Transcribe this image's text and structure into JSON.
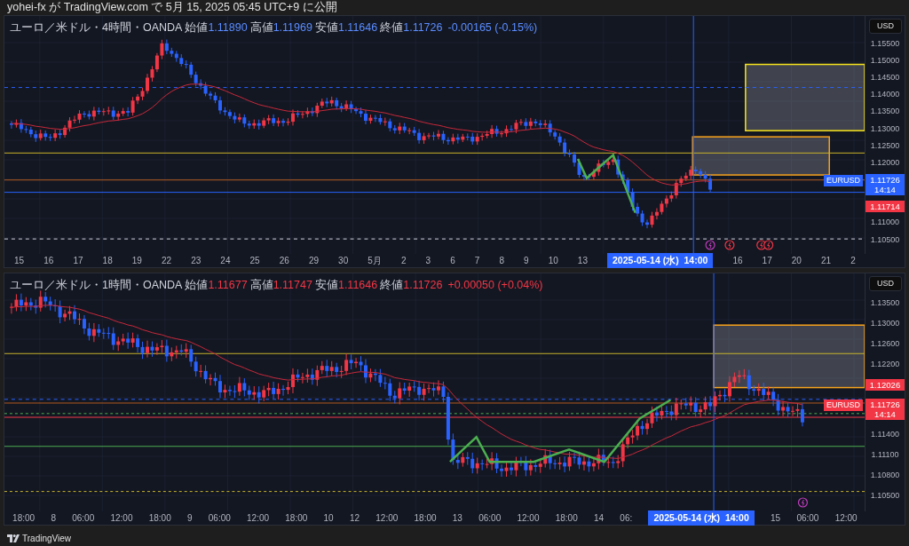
{
  "header": {
    "text": "yohei-fx が TradingView.com で 5月 15, 2025 05:45 UTC+9 に公開"
  },
  "panes": [
    {
      "symbol": "ユーロ／米ドル・4時間・OANDA",
      "color": "#5b8cff",
      "ohlc": [
        {
          "label": "始値",
          "value": "1.11890"
        },
        {
          "label": "高値",
          "value": "1.11969"
        },
        {
          "label": "安値",
          "value": "1.11646"
        },
        {
          "label": "終値",
          "value": "1.11726"
        }
      ],
      "change": "-0.00165 (-0.15%)",
      "currency": "USD",
      "symbol_tag": "EURUSD",
      "price_axis": [
        {
          "kind": "tick",
          "text": "1.15500"
        },
        {
          "kind": "tick",
          "text": "1.15000"
        },
        {
          "kind": "tick",
          "text": "1.14500"
        },
        {
          "kind": "tick",
          "text": "1.14000"
        },
        {
          "kind": "tick",
          "text": "1.13500"
        },
        {
          "kind": "tick",
          "text": "1.13000"
        },
        {
          "kind": "tick",
          "text": "1.12500"
        },
        {
          "kind": "tick",
          "text": "1.12000"
        },
        {
          "kind": "last",
          "text": "1.11726",
          "sub": "14:14",
          "color": "#2962ff"
        },
        {
          "kind": "label",
          "text": "1.11714",
          "color": "#f23645"
        },
        {
          "kind": "tick",
          "text": "1.11000"
        },
        {
          "kind": "tick",
          "text": "1.10500"
        }
      ],
      "time_axis": [
        "15",
        "16",
        "17",
        "18",
        "19",
        "22",
        "23",
        "24",
        "25",
        "26",
        "29",
        "30",
        "5月",
        "2",
        "3",
        "6",
        "7",
        "8",
        "9",
        "10",
        "13",
        "16",
        "17",
        "20",
        "21",
        "2"
      ],
      "crosshair_label": "2025-05-14 (水)  14:00"
    },
    {
      "symbol": "ユーロ／米ドル・1時間・OANDA",
      "color": "#f23645",
      "ohlc": [
        {
          "label": "始値",
          "value": "1.11677"
        },
        {
          "label": "高値",
          "value": "1.11747"
        },
        {
          "label": "安値",
          "value": "1.11646"
        },
        {
          "label": "終値",
          "value": "1.11726"
        }
      ],
      "change": "+0.00050 (+0.04%)",
      "currency": "USD",
      "symbol_tag": "EURUSD",
      "price_axis": [
        {
          "kind": "tick",
          "text": "1.13500"
        },
        {
          "kind": "tick",
          "text": "1.13000"
        },
        {
          "kind": "tick",
          "text": "1.12600"
        },
        {
          "kind": "tick",
          "text": "1.12200"
        },
        {
          "kind": "label",
          "text": "1.12026",
          "color": "#f23645"
        },
        {
          "kind": "last",
          "text": "1.11726",
          "sub": "14:14",
          "color": "#f23645"
        },
        {
          "kind": "tick",
          "text": "1.11400"
        },
        {
          "kind": "tick",
          "text": "1.11100"
        },
        {
          "kind": "tick",
          "text": "1.10800"
        },
        {
          "kind": "tick",
          "text": "1.10500"
        }
      ],
      "time_axis": [
        "18:00",
        "8",
        "06:00",
        "12:00",
        "18:00",
        "9",
        "06:00",
        "12:00",
        "18:00",
        "10",
        "12",
        "12:00",
        "18:00",
        "13",
        "06:00",
        "12:00",
        "18:00",
        "14",
        "06:",
        "15",
        "06:00",
        "12:00"
      ],
      "crosshair_label": "2025-05-14 (水)  14:00"
    }
  ],
  "footer": {
    "brand": "TradingView"
  }
}
